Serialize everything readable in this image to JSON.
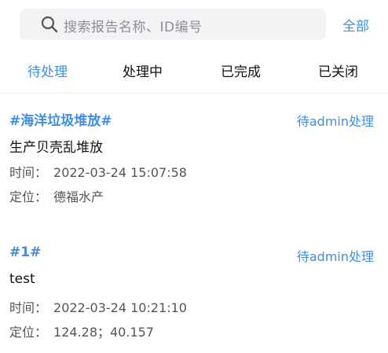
{
  "search": {
    "placeholder": "搜索报告名称、ID编号",
    "all_label": "全部"
  },
  "tabs": [
    {
      "label": "待处理",
      "active": true
    },
    {
      "label": "处理中",
      "active": false
    },
    {
      "label": "已完成",
      "active": false
    },
    {
      "label": "已关闭",
      "active": false
    }
  ],
  "reports": [
    {
      "title": "#海洋垃圾堆放#",
      "status": "待admin处理",
      "description": "生产贝壳乱堆放",
      "time_label": "时间：",
      "time_value": "2022-03-24 15:07:58",
      "location_label": "定位：",
      "location_value": "德福水产"
    },
    {
      "title": "#1#",
      "status": "待admin处理",
      "description": "test",
      "time_label": "时间：",
      "time_value": "2022-03-24 10:21:10",
      "location_label": "定位：",
      "location_value": "124.28；40.157"
    }
  ],
  "colors": {
    "accent": "#3d8ee6",
    "search_bg": "#f2f3f5",
    "text": "#111111",
    "muted": "#555555"
  },
  "icons": {
    "search": "search-icon"
  }
}
